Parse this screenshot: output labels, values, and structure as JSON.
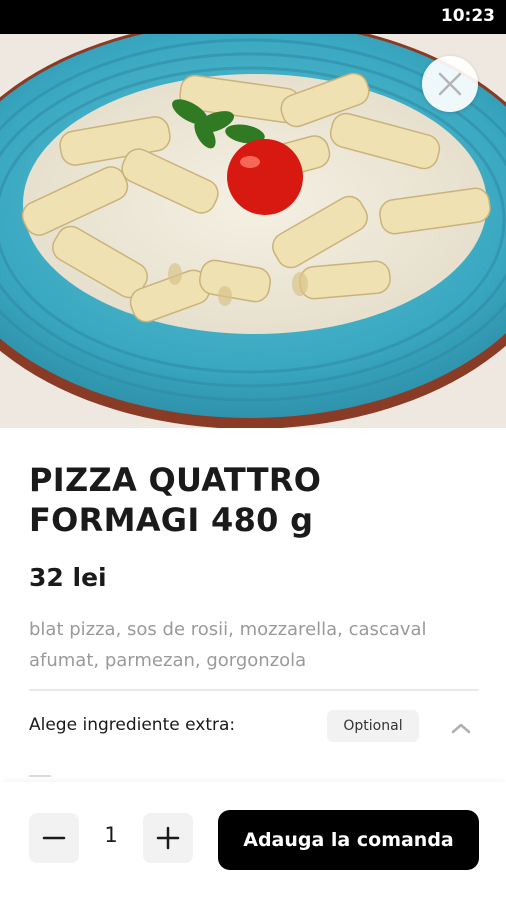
{
  "status_bar": {
    "time": "10:23"
  },
  "product": {
    "name": "PIZZA QUATTRO FORMAGI 480 g",
    "price": "32 lei",
    "description": "blat pizza, sos de rosii, mozzarella, cascaval afumat, parmezan, gorgonzola",
    "image_icon": "pasta-dish-photo"
  },
  "extras": {
    "label": "Alege ingrediente extra:",
    "badge": "Optional",
    "chevron_icon": "chevron-up-icon"
  },
  "cart": {
    "quantity": "1",
    "minus_icon": "minus-icon",
    "plus_icon": "plus-icon",
    "add_label": "Adauga la comanda"
  },
  "close_icon": "close-icon"
}
